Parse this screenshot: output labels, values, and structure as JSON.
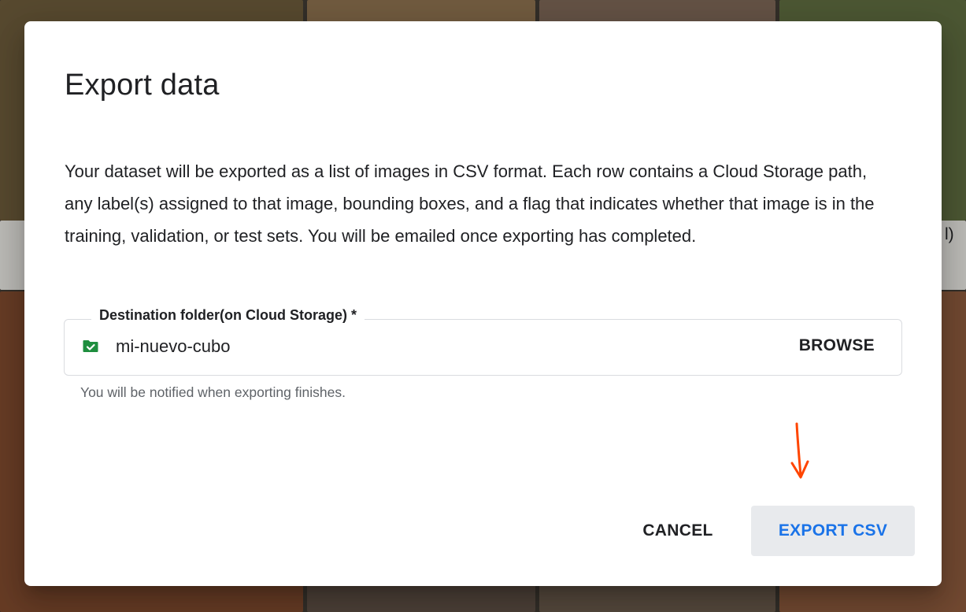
{
  "dialog": {
    "title": "Export data",
    "description": "Your dataset will be exported as a list of images in CSV format. Each row contains a Cloud Storage path, any label(s) assigned to that image, bounding boxes, and a flag that indicates whether that image is in the training, validation, or test sets. You will be emailed once exporting has completed.",
    "destination": {
      "label": "Destination folder(on Cloud Storage) *",
      "value": "mi-nuevo-cubo",
      "icon": "folder-check-icon",
      "browse_label": "BROWSE",
      "hint": "You will be notified when exporting finishes."
    },
    "actions": {
      "cancel_label": "CANCEL",
      "export_label": "EXPORT CSV"
    }
  },
  "background": {
    "partial_text": "l)"
  },
  "colors": {
    "accent": "#1a73e8",
    "folder_icon": "#1e8e3e",
    "arrow": "#ff4500",
    "export_button_bg": "#e8eaed"
  }
}
